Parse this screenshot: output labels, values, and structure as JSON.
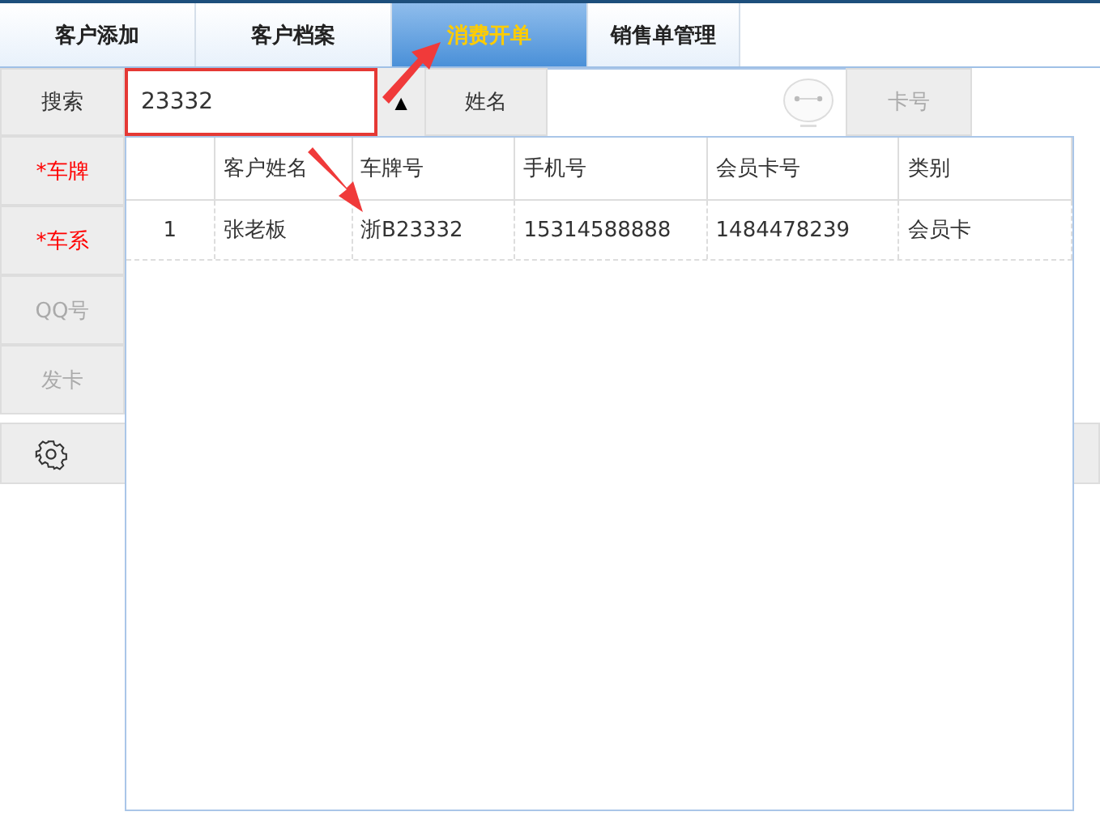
{
  "tabs": [
    {
      "label": "客户添加",
      "selected": false
    },
    {
      "label": "客户档案",
      "selected": false
    },
    {
      "label": "消费开单",
      "selected": true
    },
    {
      "label": "销售单管理",
      "selected": false
    }
  ],
  "search": {
    "label": "搜索",
    "value": "23332",
    "toggle": "▲",
    "name_label": "姓名",
    "card_label": "卡号"
  },
  "fields": [
    {
      "label": "*车牌",
      "required": true,
      "disabled": false
    },
    {
      "label": "*车系",
      "required": true,
      "disabled": false
    },
    {
      "label": "QQ号",
      "required": false,
      "disabled": true
    },
    {
      "label": "发卡",
      "required": false,
      "disabled": true
    }
  ],
  "dropdown": {
    "columns": [
      "",
      "客户姓名",
      "车牌号",
      "手机号",
      "会员卡号",
      "类别"
    ],
    "rows": [
      [
        "1",
        "张老板",
        "浙B23332",
        "15314588888",
        "1484478239",
        "会员卡"
      ]
    ]
  }
}
